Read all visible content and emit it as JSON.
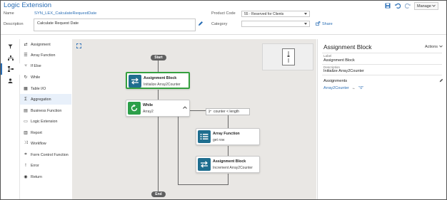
{
  "header": {
    "title": "Logic Extension",
    "manage_label": "Manage",
    "name_label": "Name",
    "name_value": "SYN_LEX_CalculateRequestDate",
    "description_label": "Description",
    "description_value": "Calculate Request Date",
    "product_code_label": "Product Code",
    "product_code_value": "55 - Reserved for Clients",
    "category_label": "Category",
    "category_value": "",
    "share_label": "Share",
    "icons": [
      "save-icon",
      "undo-icon",
      "redo-icon"
    ]
  },
  "rail": {
    "items": [
      "funnel-icon",
      "hierarchy-icon",
      "flowchart-icon",
      "person-icon"
    ],
    "active_index": 2
  },
  "palette": {
    "items": [
      {
        "label": "Assignment",
        "icon": "swap-arrows-icon"
      },
      {
        "label": "Array Function",
        "icon": "list-icon"
      },
      {
        "label": "If Else",
        "icon": "branch-icon"
      },
      {
        "label": "While",
        "icon": "loop-icon"
      },
      {
        "label": "Table I/O",
        "icon": "table-icon"
      },
      {
        "label": "Aggregation",
        "icon": "sigma-icon"
      },
      {
        "label": "Business Function",
        "icon": "grid-icon"
      },
      {
        "label": "Logic Extension",
        "icon": "doc-icon"
      },
      {
        "label": "Report",
        "icon": "report-icon"
      },
      {
        "label": "Workflow",
        "icon": "workflow-icon"
      },
      {
        "label": "Form Control Function",
        "icon": "form-icon"
      },
      {
        "label": "Error",
        "icon": "error-icon"
      },
      {
        "label": "Return",
        "icon": "return-icon"
      }
    ],
    "hover_index": 5
  },
  "canvas": {
    "start_label": "Start",
    "end_label": "End",
    "condition_text": "counter < length",
    "nodes": [
      {
        "title": "Assignment Block",
        "subtitle": "Initialize Array2Counter",
        "icon": "swap-arrows-icon",
        "color": "#1f6e8f"
      },
      {
        "title": "While",
        "subtitle": "Array2",
        "icon": "loop-icon",
        "color": "#2c9f49"
      },
      {
        "title": "Array Function",
        "subtitle": "get row",
        "icon": "list-icon",
        "color": "#1f6e8f"
      },
      {
        "title": "Assignment Block",
        "subtitle": "Increment Array2Counter",
        "icon": "swap-arrows-icon",
        "color": "#1f6e8f"
      }
    ]
  },
  "properties": {
    "title": "Assignment Block",
    "actions_label": "Actions",
    "label_caption": "Label",
    "label_value": "Assignment Block",
    "description_caption": "Description",
    "description_value": "Initialize Array2Counter",
    "assignments_heading": "Assignments",
    "assignment_target": "Array2Counter",
    "assignment_arrow": "←",
    "assignment_value": "\"0\""
  },
  "colors": {
    "accent": "#2a6eb5",
    "selected_border": "#35a03f",
    "node_blue": "#1f6e8f",
    "node_green": "#2c9f49",
    "canvas_bg": "#e9e7e4"
  }
}
